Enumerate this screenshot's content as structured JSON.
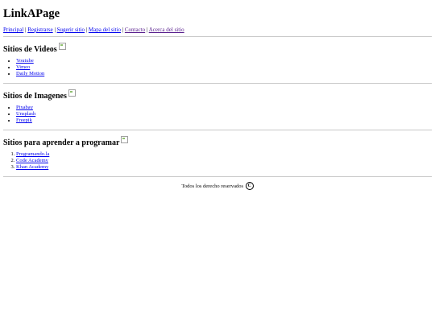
{
  "site_title": "LinkAPage",
  "nav": {
    "principal": "Principal",
    "registrarse": "Registrarse",
    "sugerir": "Sugerir sitio",
    "mapa": "Mapa del sitio",
    "contacto": "Contacto",
    "acerca": "Acerca del sitio",
    "separator": "|"
  },
  "sections": {
    "videos": {
      "title": "Sitios de Videos",
      "items": [
        "Youtube",
        "Vimeo",
        "Daily Motion"
      ]
    },
    "imagenes": {
      "title": "Sitios de Imagenes",
      "items": [
        "Pixabay",
        "Unsplash",
        "Freepik"
      ]
    },
    "programar": {
      "title": "Sitios para aprender a programar",
      "items": [
        "Programando.la",
        "Code Academy",
        "Khan Academy"
      ]
    }
  },
  "footer": {
    "text": "Todos los derecho reservados",
    "icon": "copyright-icon",
    "icon_glyph": "C"
  },
  "colors": {
    "link": "#0000ee",
    "visited_link": "#551a8b",
    "divider": "#c8c8c8"
  }
}
